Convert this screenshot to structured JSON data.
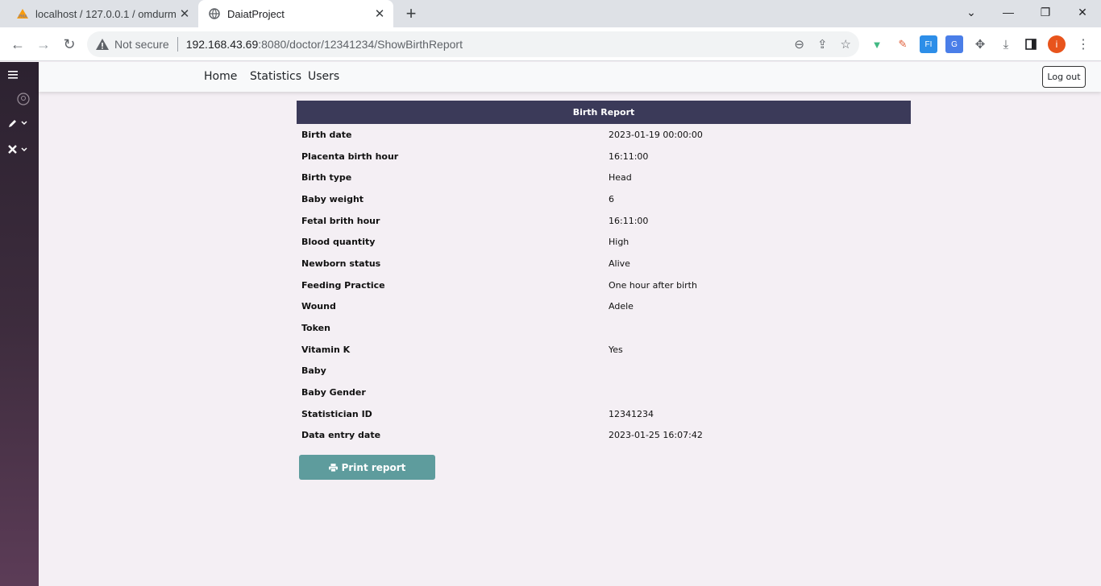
{
  "browser": {
    "tabs": [
      {
        "title": "localhost / 127.0.0.1 / omdurman",
        "close": "✕"
      },
      {
        "title": "DaiatProject",
        "close": "✕"
      }
    ],
    "new_tab": "+",
    "window_controls": {
      "minimize": "⌄",
      "restore": "—",
      "maximize": "❐",
      "close": "✕"
    },
    "address": {
      "security_label": "Not secure",
      "host": "192.168.43.69",
      "path": ":8080/doctor/12341234/ShowBirthReport"
    },
    "profile_initial": "i",
    "colors": {
      "profile": "#e8541c",
      "tabstrip": "#dee1e6"
    }
  },
  "sidebar": {
    "icons": [
      "menu-icon",
      "logo-icon",
      "pencil-icon",
      "tools-icon"
    ]
  },
  "nav": {
    "links": [
      "Home",
      "Statistics",
      "Users"
    ],
    "logout_label": "Log out"
  },
  "report": {
    "title": "Birth Report",
    "header_color": "#3b3a59",
    "rows": [
      {
        "label": "Birth date",
        "value": "2023-01-19 00:00:00"
      },
      {
        "label": "Placenta birth hour",
        "value": "16:11:00"
      },
      {
        "label": "Birth type",
        "value": "Head"
      },
      {
        "label": "Baby weight",
        "value": "6"
      },
      {
        "label": "Fetal brith hour",
        "value": "16:11:00"
      },
      {
        "label": "Blood quantity",
        "value": "High"
      },
      {
        "label": "Newborn status",
        "value": "Alive"
      },
      {
        "label": "Feeding Practice",
        "value": "One hour after birth"
      },
      {
        "label": "Wound",
        "value": "Adele"
      },
      {
        "label": "Token",
        "value": ""
      },
      {
        "label": "Vitamin K",
        "value": "Yes"
      },
      {
        "label": "Baby",
        "value": ""
      },
      {
        "label": "Baby Gender",
        "value": ""
      },
      {
        "label": "Statistician ID",
        "value": "12341234"
      },
      {
        "label": "Data entry date",
        "value": "2023-01-25 16:07:42"
      }
    ],
    "print_label": "Print report",
    "print_color": "#5e9c9d"
  }
}
